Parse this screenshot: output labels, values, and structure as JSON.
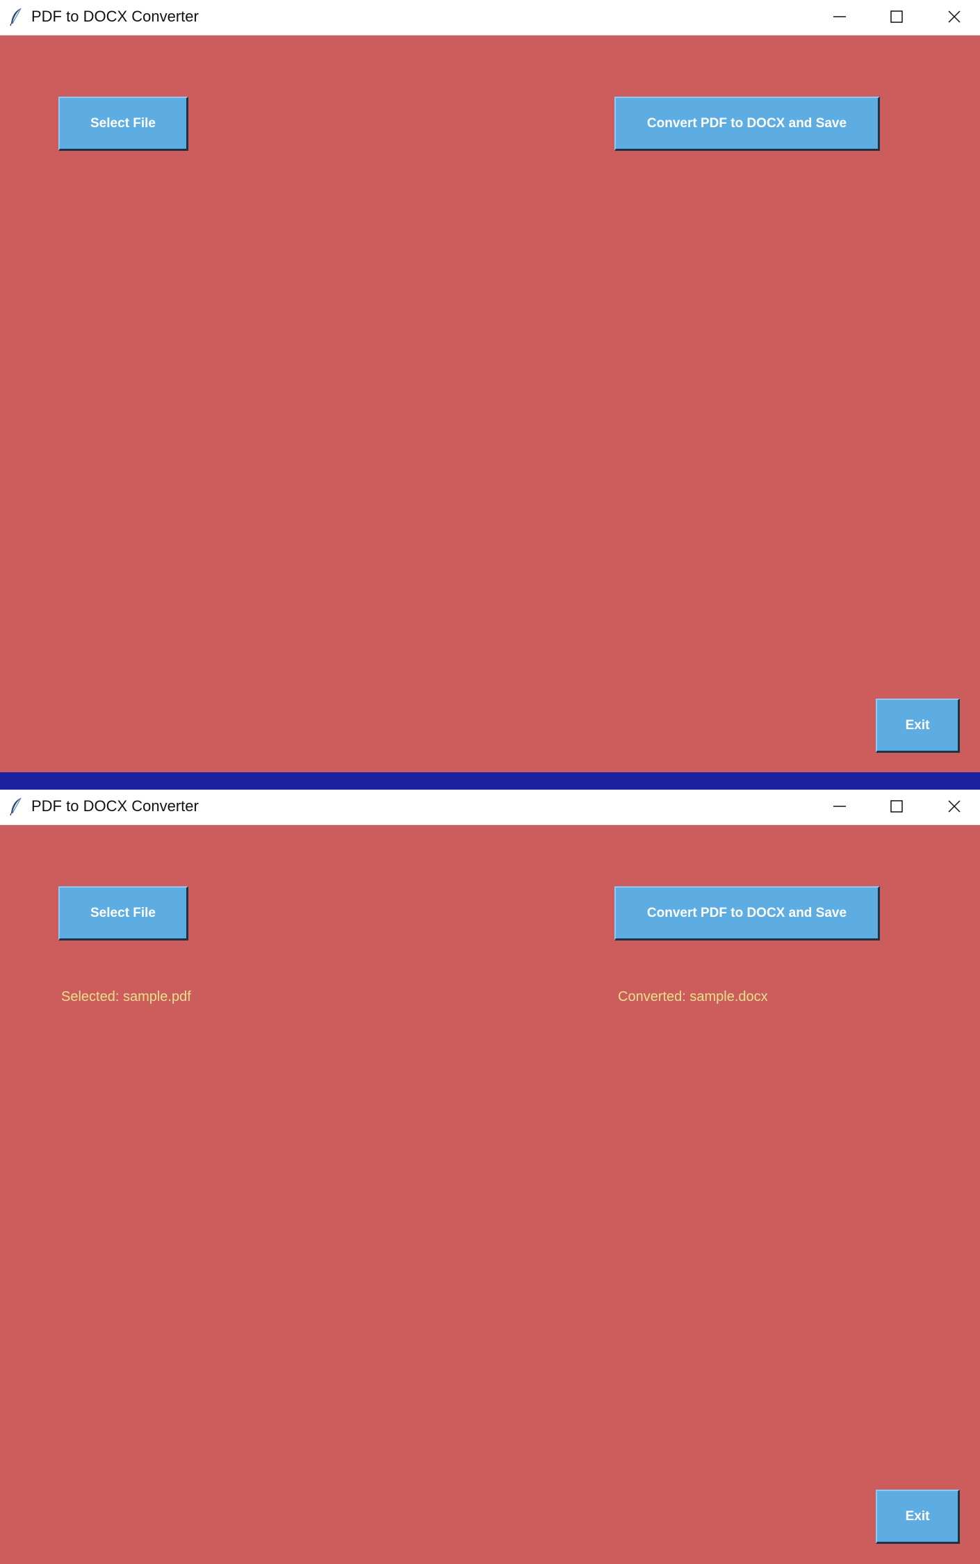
{
  "colors": {
    "background": "#cd5c5c",
    "button": "#5dade2",
    "button_text": "#ffffff",
    "status_text": "#e8e08a",
    "divider": "#1a22a0"
  },
  "windows": [
    {
      "title": "PDF to DOCX Converter",
      "icons": {
        "app": "feather-icon",
        "minimize": "minimize-icon",
        "maximize": "maximize-icon",
        "close": "close-icon"
      },
      "buttons": {
        "select_file": "Select File",
        "convert": "Convert PDF to DOCX and Save",
        "exit": "Exit"
      }
    },
    {
      "title": "PDF to DOCX Converter",
      "icons": {
        "app": "feather-icon",
        "minimize": "minimize-icon",
        "maximize": "maximize-icon",
        "close": "close-icon"
      },
      "buttons": {
        "select_file": "Select File",
        "convert": "Convert PDF to DOCX and Save",
        "exit": "Exit"
      },
      "status": {
        "selected": "Selected: sample.pdf",
        "converted": "Converted: sample.docx"
      }
    }
  ]
}
